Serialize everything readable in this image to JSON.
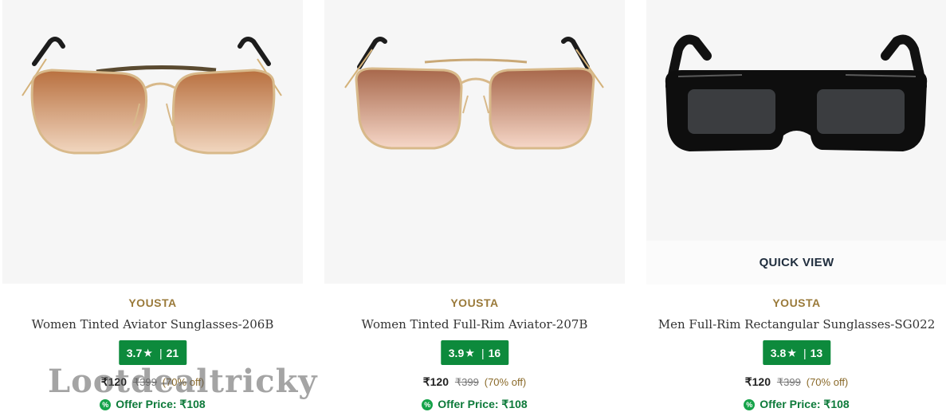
{
  "products": [
    {
      "brand": "YOUSTA",
      "name": "Women Tinted Aviator Sunglasses-206B",
      "rating": "3.7",
      "reviews": "21",
      "price": "₹120",
      "mrp": "₹399",
      "discount": "(70% off)",
      "offer_label": "Offer Price: ₹108",
      "image_icon": "aviator-gold-brown-sunglasses"
    },
    {
      "brand": "YOUSTA",
      "name": "Women Tinted Full-Rim Aviator-207B",
      "rating": "3.9",
      "reviews": "16",
      "price": "₹120",
      "mrp": "₹399",
      "discount": "(70% off)",
      "offer_label": "Offer Price: ₹108",
      "image_icon": "aviator-gold-pink-sunglasses"
    },
    {
      "brand": "YOUSTA",
      "name": "Men Full-Rim Rectangular Sunglasses-SG022",
      "rating": "3.8",
      "reviews": "13",
      "price": "₹120",
      "mrp": "₹399",
      "discount": "(70% off)",
      "offer_label": "Offer Price: ₹108",
      "quick_view": "QUICK VIEW",
      "image_icon": "black-rectangular-sunglasses"
    }
  ],
  "rating_symbols": {
    "star": "★",
    "separator": "|"
  },
  "offer_icon_glyph": "%",
  "watermark": "Lootdealtricky",
  "colors": {
    "rating_bg": "#0d8a3c",
    "brand": "#9a7a3a",
    "offer": "#0d7a3a",
    "image_bg": "#f6f6f6"
  }
}
